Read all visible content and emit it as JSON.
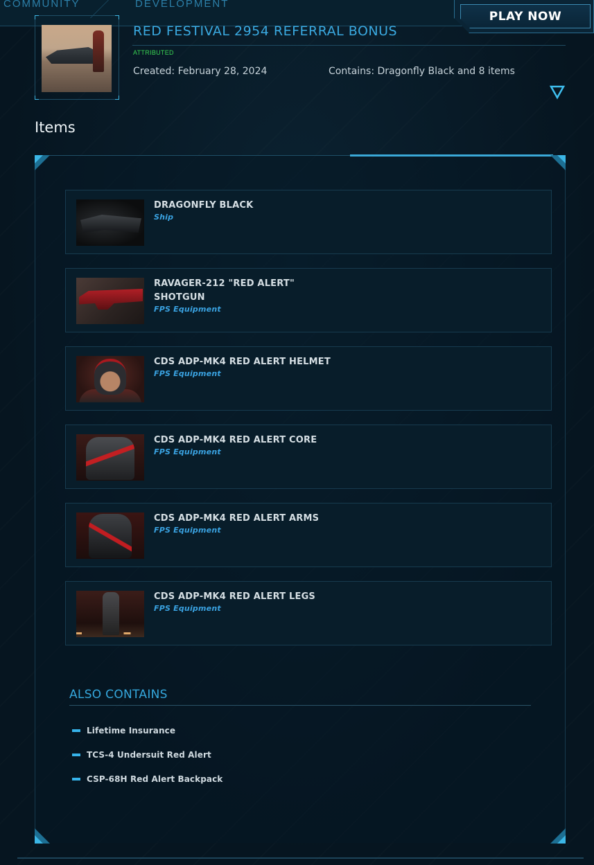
{
  "nav": {
    "community": "COMMUNITY",
    "development": "DEVELOPMENT",
    "play_now": "PLAY NOW"
  },
  "pledge": {
    "title": "RED FESTIVAL 2954 REFERRAL BONUS",
    "status": "ATTRIBUTED",
    "created": "Created: February 28, 2024",
    "contains": "Contains: Dragonfly Black and 8 items"
  },
  "items_heading": "Items",
  "items": [
    {
      "name": "DRAGONFLY BLACK",
      "type": "Ship"
    },
    {
      "name": "RAVAGER-212 \"RED ALERT\" SHOTGUN",
      "type": "FPS Equipment"
    },
    {
      "name": "CDS ADP-MK4 RED ALERT HELMET",
      "type": "FPS Equipment"
    },
    {
      "name": "CDS ADP-MK4 RED ALERT CORE",
      "type": "FPS Equipment"
    },
    {
      "name": "CDS ADP-MK4 RED ALERT ARMS",
      "type": "FPS Equipment"
    },
    {
      "name": "CDS ADP-MK4 RED ALERT LEGS",
      "type": "FPS Equipment"
    }
  ],
  "also_contains": {
    "heading": "ALSO CONTAINS",
    "items": [
      "Lifetime Insurance",
      "TCS-4 Undersuit Red Alert",
      "CSP-68H Red Alert Backpack"
    ]
  },
  "colors": {
    "accent": "#3aa9e0",
    "attributed": "#39d352",
    "background": "#071823"
  }
}
